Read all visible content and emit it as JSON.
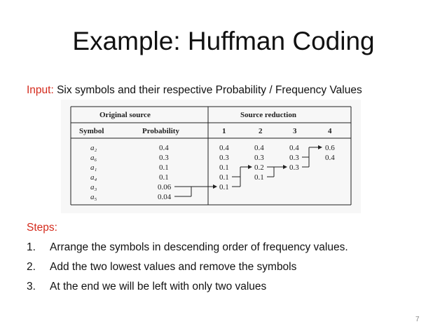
{
  "slide": {
    "title": "Example: Huffman Coding",
    "input_label": "Input:",
    "input_text": "Six symbols and their respective Probability / Frequency Values",
    "steps_label": "Steps:",
    "steps": [
      {
        "num": "1.",
        "text": "Arrange the symbols in descending order of frequency values."
      },
      {
        "num": "2.",
        "text": "Add the two lowest values and remove the symbols"
      },
      {
        "num": "3.",
        "text": "At the end we will be left with only two values"
      }
    ],
    "page_number": "7",
    "accent_color": "#d42a1c"
  },
  "table": {
    "group_headers": {
      "original": "Original source",
      "reduction": "Source reduction"
    },
    "columns": [
      "Symbol",
      "Probability",
      "1",
      "2",
      "3",
      "4"
    ],
    "rows": [
      {
        "symbol": "a₂",
        "probability": "0.4",
        "r1": "0.4",
        "r2": "0.4",
        "r3": "0.4",
        "r4": "0.6"
      },
      {
        "symbol": "a₆",
        "probability": "0.3",
        "r1": "0.3",
        "r2": "0.3",
        "r3": "0.3",
        "r4": "0.4"
      },
      {
        "symbol": "a₁",
        "probability": "0.1",
        "r1": "0.1",
        "r2": "0.2",
        "r3": "0.3",
        "r4": ""
      },
      {
        "symbol": "a₄",
        "probability": "0.1",
        "r1": "0.1",
        "r2": "0.1",
        "r3": "",
        "r4": ""
      },
      {
        "symbol": "a₃",
        "probability": "0.06",
        "r1": "0.1",
        "r2": "",
        "r3": "",
        "r4": ""
      },
      {
        "symbol": "a₅",
        "probability": "0.04",
        "r1": "",
        "r2": "",
        "r3": "",
        "r4": ""
      }
    ]
  }
}
